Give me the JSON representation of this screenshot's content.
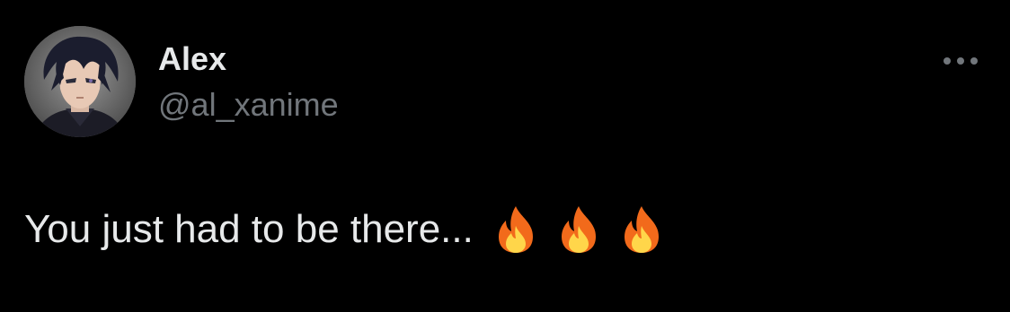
{
  "tweet": {
    "author": {
      "display_name": "Alex",
      "handle": "@al_xanime",
      "avatar_icon": "anime-character-avatar-icon"
    },
    "more_icon": "ellipsis-icon",
    "text": "You just had to be there...",
    "emojis": [
      "fire-icon",
      "fire-icon",
      "fire-icon"
    ]
  },
  "colors": {
    "background": "#000000",
    "primary_text": "#e7e9ea",
    "secondary_text": "#71767b",
    "fire_outer": "#f26a1b",
    "fire_inner": "#ffd64a"
  }
}
